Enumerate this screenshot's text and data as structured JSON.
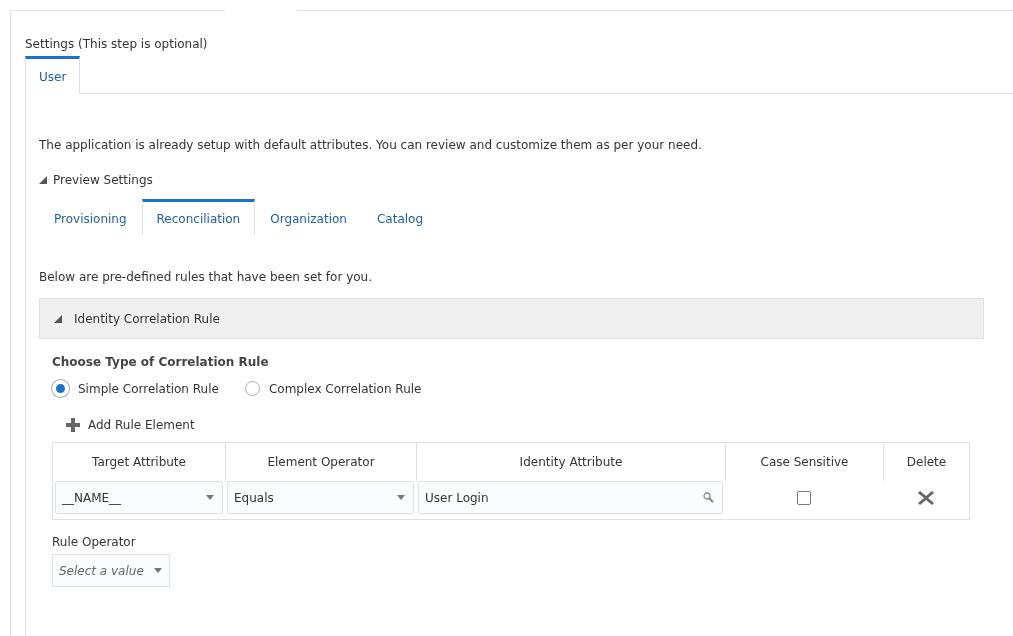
{
  "section_title": "Settings (This step is optional)",
  "tabs": [
    {
      "label": "User",
      "selected": true
    }
  ],
  "description": "The application is already setup with default attributes. You can review and customize them as per your need.",
  "preview": {
    "label": "Preview Settings",
    "expanded": true
  },
  "sub_tabs": [
    {
      "label": "Provisioning",
      "selected": false
    },
    {
      "label": "Reconciliation",
      "selected": true
    },
    {
      "label": "Organization",
      "selected": false
    },
    {
      "label": "Catalog",
      "selected": false
    }
  ],
  "intro": "Below are pre-defined rules that have been set for you.",
  "panel": {
    "title": "Identity Correlation Rule",
    "expanded": true
  },
  "rule_type": {
    "label": "Choose Type of Correlation Rule",
    "options": [
      {
        "label": "Simple Correlation Rule",
        "selected": true
      },
      {
        "label": "Complex Correlation Rule",
        "selected": false
      }
    ]
  },
  "add_button": "Add Rule Element",
  "table": {
    "columns": [
      "Target Attribute",
      "Element Operator",
      "Identity Attribute",
      "Case Sensitive",
      "Delete"
    ],
    "rows": [
      {
        "target_attribute": "__NAME__",
        "element_operator": "Equals",
        "identity_attribute": "User Login",
        "case_sensitive": false
      }
    ]
  },
  "rule_operator": {
    "label": "Rule Operator",
    "placeholder": "Select a value"
  }
}
